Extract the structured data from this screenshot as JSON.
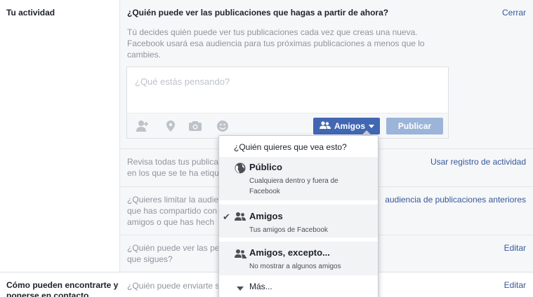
{
  "left_labels": {
    "activity": "Tu actividad",
    "find_contact_line1": "Cómo pueden encontrarte y",
    "find_contact_line2": "ponerse en contacto"
  },
  "panel": {
    "title": "¿Quién puede ver las publicaciones que hagas a partir de ahora?",
    "close": "Cerrar",
    "description": "Tú decides quién puede ver tus publicaciones cada vez que creas una nueva. Facebook usará esa audiencia para tus próximas publicaciones a menos que lo cambies.",
    "composer_placeholder": "¿Qué estás pensando?",
    "audience_button": "Amigos",
    "publish_button": "Publicar"
  },
  "rows": {
    "review_line1": "Revisa todas tus publica",
    "review_line2": "en los que se te ha etiqu",
    "review_link": "Usar registro de actividad",
    "limit_line1": "¿Quieres limitar la audie",
    "limit_line2": "que has compartido con",
    "limit_line3": "amigos o que has hech",
    "limit_link": "audiencia de publicaciones anteriores",
    "follow_line1": "¿Quién puede ver las pe",
    "follow_line2": "que sigues?",
    "follow_link": "Editar",
    "requests_line1": "¿Quién puede enviarte s",
    "requests_link": "Editar"
  },
  "dropdown": {
    "header": "¿Quién quieres que vea esto?",
    "items": [
      {
        "title": "Público",
        "sub": "Cualquiera dentro y fuera de Facebook",
        "icon": "globe-icon"
      },
      {
        "title": "Amigos",
        "sub": "Tus amigos de Facebook",
        "icon": "friends-icon",
        "selected": "✔"
      },
      {
        "title": "Amigos, excepto...",
        "sub": "No mostrar a algunos amigos",
        "icon": "friends-except-icon"
      },
      {
        "title": "Más...",
        "icon": "triangle-down-icon"
      }
    ]
  },
  "colors": {
    "link": "#365899",
    "primary_button": "#4267b2",
    "disabled_button": "#9cb4d8"
  }
}
